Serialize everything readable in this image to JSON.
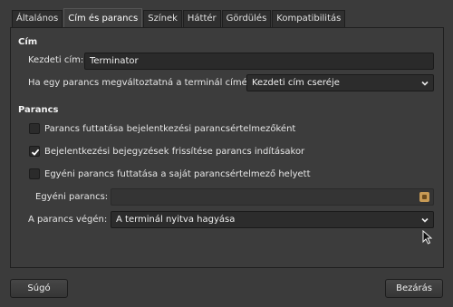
{
  "tabs": [
    {
      "label": "Általános",
      "active": false
    },
    {
      "label": "Cím és parancs",
      "active": true
    },
    {
      "label": "Színek",
      "active": false
    },
    {
      "label": "Háttér",
      "active": false
    },
    {
      "label": "Gördülés",
      "active": false
    },
    {
      "label": "Kompatibilitás",
      "active": false
    }
  ],
  "title_section": {
    "heading": "Cím",
    "initial_title_label": "Kezdeti cím:",
    "initial_title_value": "Terminator",
    "dynamic_title_label": "Ha egy parancs megváltoztatná a terminál címét:",
    "dynamic_title_value": "Kezdeti cím cseréje"
  },
  "command_section": {
    "heading": "Parancs",
    "login_shell_label": "Parancs futtatása bejelentkezési parancsértelmezőként",
    "login_shell_checked": false,
    "update_records_label": "Bejelentkezési bejegyzések frissítése parancs indításakor",
    "update_records_checked": true,
    "custom_command_toggle_label": "Egyéni parancs futtatása a saját parancsértelmező helyett",
    "custom_command_checked": false,
    "custom_command_label": "Egyéni parancs:",
    "custom_command_value": "",
    "on_exit_label": "A parancs végén:",
    "on_exit_value": "A terminál nyitva hagyása"
  },
  "footer": {
    "help_label": "Súgó",
    "close_label": "Bezárás"
  },
  "colors": {
    "background": "#3b3b3b",
    "field": "#2a2a2a",
    "check": "#ffffff"
  }
}
